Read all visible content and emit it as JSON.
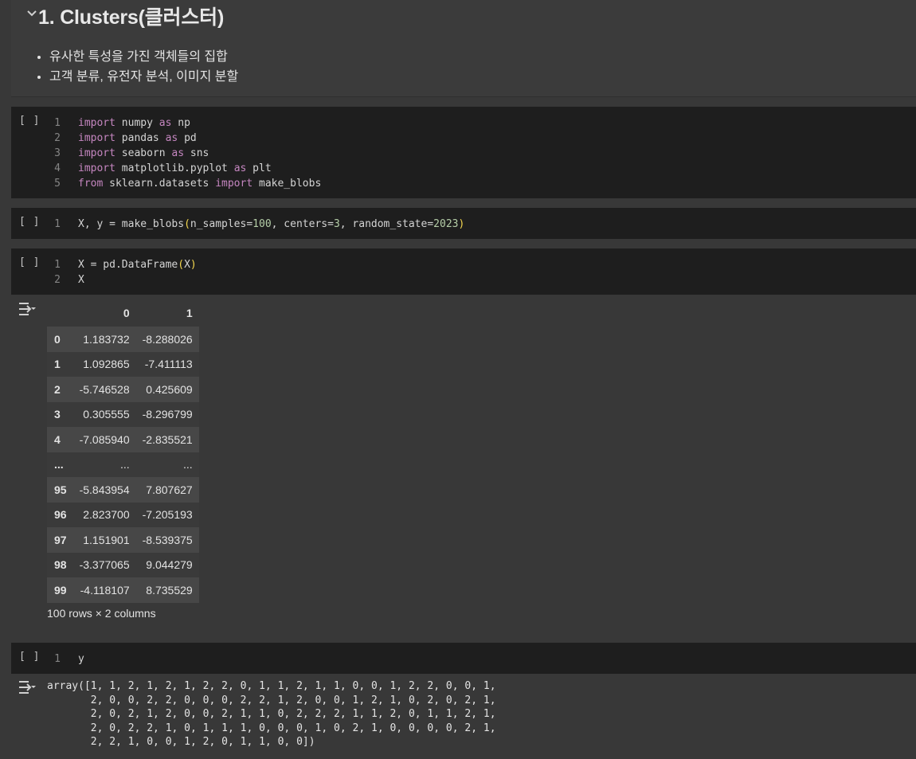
{
  "markdown": {
    "heading": "1. Clusters(클러스터)",
    "bullets": [
      "유사한 특성을 가진 객체들의 집합",
      "고객 분류, 유전자 분석, 이미지 분할"
    ]
  },
  "cells": {
    "cell1": {
      "run_label": "[ ]"
    },
    "cell2": {
      "run_label": "[ ]"
    },
    "cell3": {
      "run_label": "[ ]"
    },
    "cell4": {
      "run_label": "[ ]"
    }
  },
  "dataframe": {
    "columns": [
      "0",
      "1"
    ],
    "rows": [
      [
        "0",
        "1.183732",
        "-8.288026"
      ],
      [
        "1",
        "1.092865",
        "-7.411113"
      ],
      [
        "2",
        "-5.746528",
        "0.425609"
      ],
      [
        "3",
        "0.305555",
        "-8.296799"
      ],
      [
        "4",
        "-7.085940",
        "-2.835521"
      ],
      [
        "...",
        "...",
        "..."
      ],
      [
        "95",
        "-5.843954",
        "7.807627"
      ],
      [
        "96",
        "2.823700",
        "-7.205193"
      ],
      [
        "97",
        "1.151901",
        "-8.539375"
      ],
      [
        "98",
        "-3.377065",
        "9.044279"
      ],
      [
        "99",
        "-4.118107",
        "8.735529"
      ]
    ],
    "shape_text": "100 rows × 2 columns"
  },
  "array_output": "array([1, 1, 2, 1, 2, 1, 2, 2, 0, 1, 1, 2, 1, 1, 0, 0, 1, 2, 2, 0, 0, 1,\n       2, 0, 0, 2, 2, 0, 0, 0, 2, 2, 1, 2, 0, 0, 1, 2, 1, 0, 2, 0, 2, 1,\n       2, 0, 2, 1, 2, 0, 0, 2, 1, 1, 0, 2, 2, 2, 1, 1, 2, 0, 1, 1, 2, 1,\n       2, 0, 2, 2, 1, 0, 1, 1, 1, 0, 0, 0, 1, 0, 2, 1, 0, 0, 0, 0, 2, 1,\n       2, 2, 1, 0, 0, 1, 2, 0, 1, 1, 0, 0])",
  "colors": {
    "background": "#383838",
    "code_bg": "#1e1e1e",
    "keyword": "#c586c0",
    "number": "#b5cea8",
    "paren": "#f3d64e"
  }
}
